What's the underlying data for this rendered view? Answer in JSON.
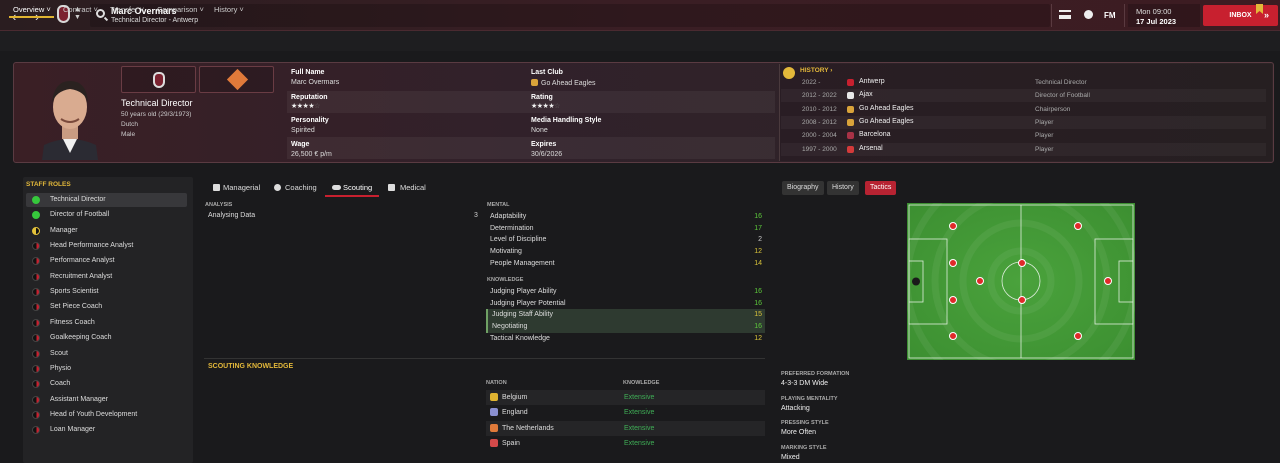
{
  "topbar": {
    "name": "Marc Overmars",
    "subtitle": "Technical Director - Antwerp",
    "time": "Mon 09:00",
    "date": "17 Jul 2023",
    "inbox_label": "INBOX",
    "fm_label": "FM"
  },
  "subtabs": [
    "Overview",
    "Contract",
    "Transfer",
    "Comparison",
    "History"
  ],
  "profile": {
    "role": "Technical Director",
    "age": "50 years old (29/3/1973)",
    "nationality": "Dutch",
    "gender": "Male"
  },
  "details": {
    "full_name_label": "Full Name",
    "full_name": "Marc Overmars",
    "reputation_label": "Reputation",
    "reputation_stars": 3.5,
    "personality_label": "Personality",
    "personality": "Spirited",
    "wage_label": "Wage",
    "wage": "26,500 € p/m",
    "last_club_label": "Last Club",
    "last_club": "Go Ahead Eagles",
    "rating_label": "Rating",
    "rating_stars": 4,
    "media_label": "Media Handling Style",
    "media": "None",
    "expires_label": "Expires",
    "expires": "30/6/2026"
  },
  "history": {
    "title": "HISTORY",
    "rows": [
      {
        "years": "2022 -",
        "club": "Antwerp",
        "role": "Technical Director",
        "color": "#c8202f"
      },
      {
        "years": "2012 - 2022",
        "club": "Ajax",
        "role": "Director of Football",
        "color": "#e8e8e8"
      },
      {
        "years": "2010 - 2012",
        "club": "Go Ahead Eagles",
        "role": "Chairperson",
        "color": "#d9a33a"
      },
      {
        "years": "2008 - 2012",
        "club": "Go Ahead Eagles",
        "role": "Player",
        "color": "#d9a33a"
      },
      {
        "years": "2000 - 2004",
        "club": "Barcelona",
        "role": "Player",
        "color": "#a83246"
      },
      {
        "years": "1997 - 2000",
        "club": "Arsenal",
        "role": "Player",
        "color": "#d43a3a"
      }
    ]
  },
  "staff_roles": {
    "title": "STAFF ROLES",
    "items": [
      {
        "label": "Technical Director",
        "level": "green",
        "selected": true
      },
      {
        "label": "Director of Football",
        "level": "green"
      },
      {
        "label": "Manager",
        "level": "half"
      },
      {
        "label": "Head Performance Analyst",
        "level": "quarter"
      },
      {
        "label": "Performance Analyst",
        "level": "quarter"
      },
      {
        "label": "Recruitment Analyst",
        "level": "quarter"
      },
      {
        "label": "Sports Scientist",
        "level": "quarter"
      },
      {
        "label": "Set Piece Coach",
        "level": "quarter"
      },
      {
        "label": "Fitness Coach",
        "level": "quarter"
      },
      {
        "label": "Goalkeeping Coach",
        "level": "quarter"
      },
      {
        "label": "Scout",
        "level": "quarter"
      },
      {
        "label": "Physio",
        "level": "quarter"
      },
      {
        "label": "Coach",
        "level": "quarter"
      },
      {
        "label": "Assistant Manager",
        "level": "quarter"
      },
      {
        "label": "Head of Youth Development",
        "level": "quarter"
      },
      {
        "label": "Loan Manager",
        "level": "quarter"
      }
    ]
  },
  "attribute_tabs": [
    "Managerial",
    "Coaching",
    "Scouting",
    "Medical"
  ],
  "analysis": {
    "title": "ANALYSIS",
    "label": "Analysing Data",
    "value": "3"
  },
  "mental": {
    "title": "MENTAL",
    "rows": [
      {
        "label": "Adaptability",
        "value": "16",
        "cls": "green"
      },
      {
        "label": "Determination",
        "value": "17",
        "cls": "green"
      },
      {
        "label": "Level of Discipline",
        "value": "2",
        "cls": ""
      },
      {
        "label": "Motivating",
        "value": "12",
        "cls": "yellow"
      },
      {
        "label": "People Management",
        "value": "14",
        "cls": "yellow"
      }
    ]
  },
  "knowledge": {
    "title": "KNOWLEDGE",
    "rows": [
      {
        "label": "Judging Player Ability",
        "value": "16",
        "cls": "green"
      },
      {
        "label": "Judging Player Potential",
        "value": "16",
        "cls": "green"
      },
      {
        "label": "Judging Staff Ability",
        "value": "15",
        "cls": "yellow",
        "hl": true
      },
      {
        "label": "Negotiating",
        "value": "16",
        "cls": "green",
        "hl": true
      },
      {
        "label": "Tactical Knowledge",
        "value": "12",
        "cls": "yellow"
      }
    ]
  },
  "scouting_knowledge": {
    "title": "SCOUTING KNOWLEDGE",
    "nation_header": "NATION",
    "knowledge_header": "KNOWLEDGE",
    "rows": [
      {
        "nation": "Belgium",
        "level": "Extensive",
        "color": "#e0b431"
      },
      {
        "nation": "England",
        "level": "Extensive",
        "color": "#8a8fd0"
      },
      {
        "nation": "The Netherlands",
        "level": "Extensive",
        "color": "#e07a3a"
      },
      {
        "nation": "Spain",
        "level": "Extensive",
        "color": "#d44a4a"
      }
    ]
  },
  "right_tabs": [
    "Biography",
    "History",
    "Tactics"
  ],
  "tactics": {
    "formation_label": "PREFERRED FORMATION",
    "formation": "4-3-3 DM Wide",
    "mentality_label": "PLAYING MENTALITY",
    "mentality": "Attacking",
    "pressing_label": "PRESSING STYLE",
    "pressing": "More Often",
    "marking_label": "MARKING STYLE",
    "marking": "Mixed"
  }
}
